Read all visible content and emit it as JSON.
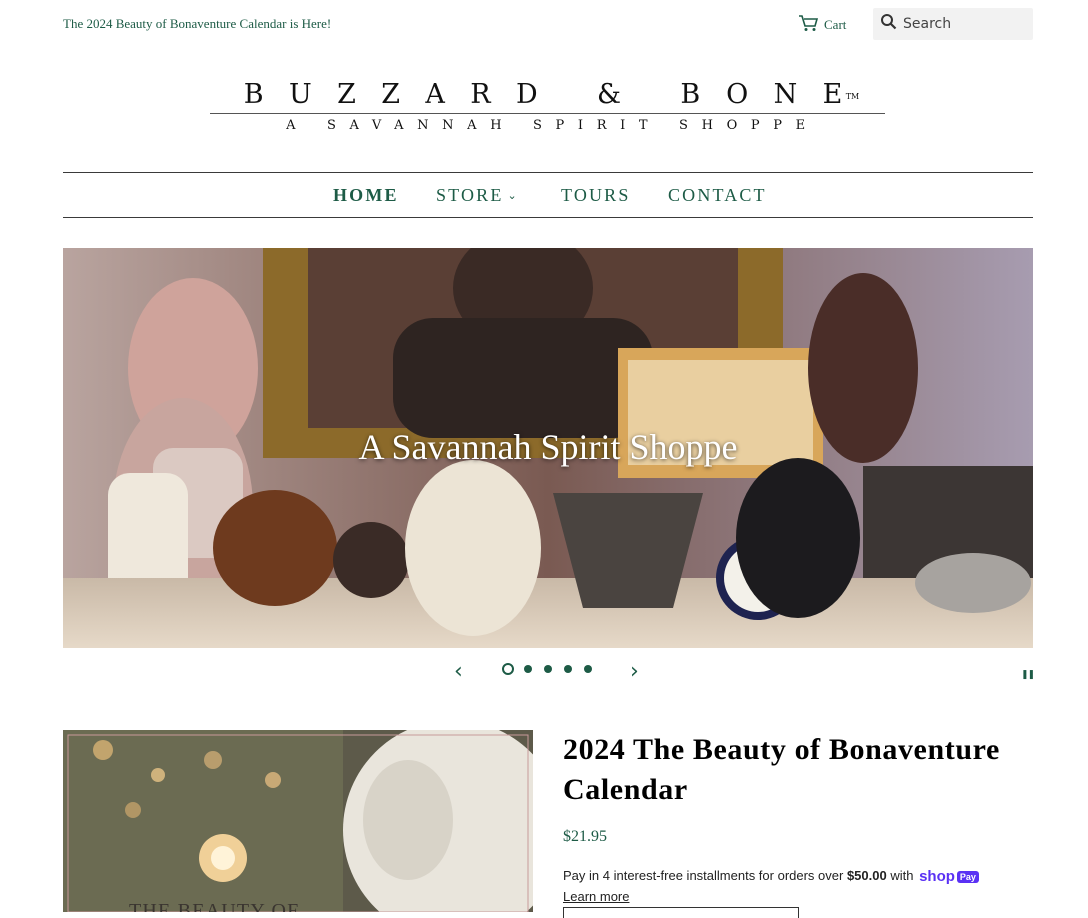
{
  "announcement": "The 2024 Beauty of Bonaventure Calendar is Here!",
  "header": {
    "cart_label": "Cart",
    "search_placeholder": "Search"
  },
  "logo": {
    "main": "BUZZARD & BONE",
    "trademark": "TM",
    "tagline": "A SAVANNAH SPIRIT SHOPPE"
  },
  "nav": {
    "items": [
      {
        "label": "HOME",
        "active": true
      },
      {
        "label": "STORE",
        "dropdown": true
      },
      {
        "label": "TOURS"
      },
      {
        "label": "CONTACT"
      }
    ]
  },
  "hero": {
    "caption": "A Savannah Spirit Shoppe",
    "slide_count": 5,
    "active_slide": 1,
    "prev_icon": "chevron-left-icon",
    "next_icon": "chevron-right-icon",
    "pause_icon": "pause-icon"
  },
  "product": {
    "image_text": "THE BEAUTY OF",
    "title": "2024 The Beauty of Bonaventure Calendar",
    "price": "$21.95",
    "installments_prefix": "Pay in 4 interest-free installments for orders over ",
    "installments_threshold": "$50.00",
    "installments_suffix": " with ",
    "shop_pay_word": "shop",
    "shop_pay_badge": "Pay",
    "learn_more": "Learn more"
  },
  "colors": {
    "accent_green": "#1d5b46",
    "shop_pay_purple": "#5a31f4"
  }
}
